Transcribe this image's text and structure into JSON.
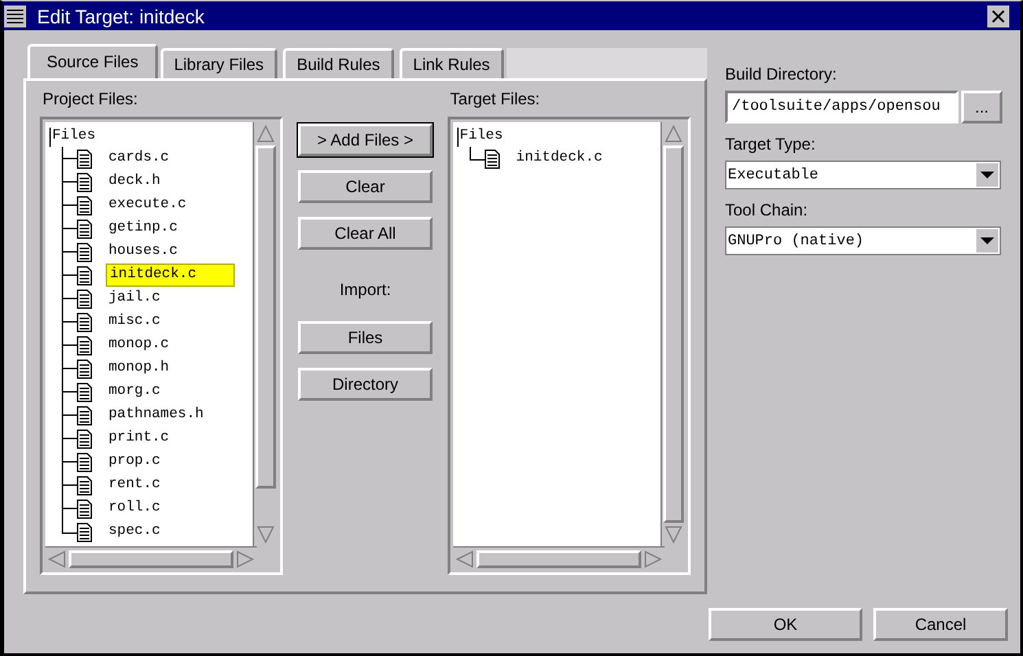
{
  "window": {
    "title": "Edit Target: initdeck"
  },
  "tabs": [
    {
      "label": "Source Files",
      "selected": true
    },
    {
      "label": "Library Files",
      "selected": false
    },
    {
      "label": "Build Rules",
      "selected": false
    },
    {
      "label": "Link Rules",
      "selected": false
    }
  ],
  "project_files": {
    "label": "Project Files:",
    "tree": {
      "label": "Files",
      "children": [
        {
          "label": "cards.c",
          "selected": false
        },
        {
          "label": "deck.h",
          "selected": false
        },
        {
          "label": "execute.c",
          "selected": false
        },
        {
          "label": "getinp.c",
          "selected": false
        },
        {
          "label": "houses.c",
          "selected": false
        },
        {
          "label": "initdeck.c",
          "selected": true
        },
        {
          "label": "jail.c",
          "selected": false
        },
        {
          "label": "misc.c",
          "selected": false
        },
        {
          "label": "monop.c",
          "selected": false
        },
        {
          "label": "monop.h",
          "selected": false
        },
        {
          "label": "morg.c",
          "selected": false
        },
        {
          "label": "pathnames.h",
          "selected": false
        },
        {
          "label": "print.c",
          "selected": false
        },
        {
          "label": "prop.c",
          "selected": false
        },
        {
          "label": "rent.c",
          "selected": false
        },
        {
          "label": "roll.c",
          "selected": false
        },
        {
          "label": "spec.c",
          "selected": false
        }
      ]
    }
  },
  "middle_buttons": [
    {
      "label": "> Add Files >",
      "default": true
    },
    {
      "label": "Clear",
      "default": false
    },
    {
      "label": "Clear All",
      "default": false
    }
  ],
  "import": {
    "label": "Import:",
    "buttons": [
      {
        "label": "Files"
      },
      {
        "label": "Directory"
      }
    ]
  },
  "target_files": {
    "label": "Target Files:",
    "tree": {
      "label": "Files",
      "children": [
        {
          "label": "initdeck.c",
          "selected": false
        }
      ]
    }
  },
  "build_directory": {
    "label": "Build Directory:",
    "value": "/toolsuite/apps/opensou",
    "browse_button": "..."
  },
  "target_type": {
    "label": "Target Type:",
    "value": "Executable"
  },
  "tool_chain": {
    "label": "Tool Chain:",
    "value": "GNUPro (native)"
  },
  "buttons": [
    {
      "label": "OK"
    },
    {
      "label": "Cancel"
    }
  ]
}
